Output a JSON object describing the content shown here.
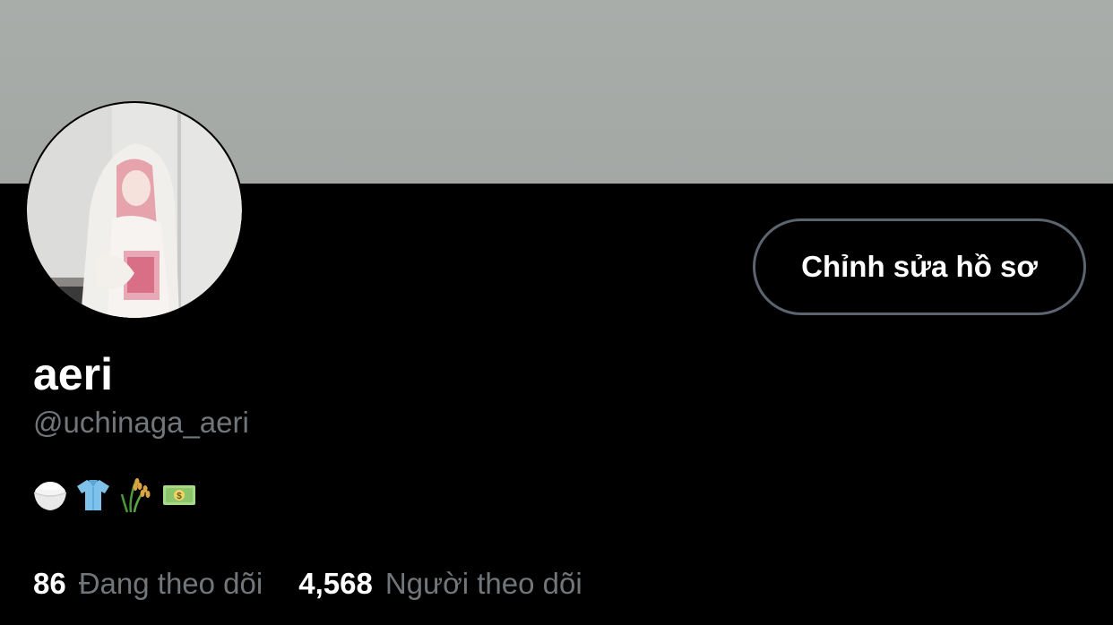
{
  "profile": {
    "display_name": "aeri",
    "handle": "@uchinaga_aeri",
    "edit_button_label": "Chỉnh sửa hồ sơ",
    "bio_emojis": [
      "rice-bowl",
      "shirt",
      "rice-plant",
      "money-bill"
    ]
  },
  "stats": {
    "following_count": "86",
    "following_label": "Đang theo dõi",
    "followers_count": "4,568",
    "followers_label": "Người theo dõi"
  },
  "colors": {
    "background": "#000000",
    "banner": "#a6aba8",
    "primary_text": "#ffffff",
    "secondary_text": "#71767b",
    "button_border": "#5b6470"
  }
}
